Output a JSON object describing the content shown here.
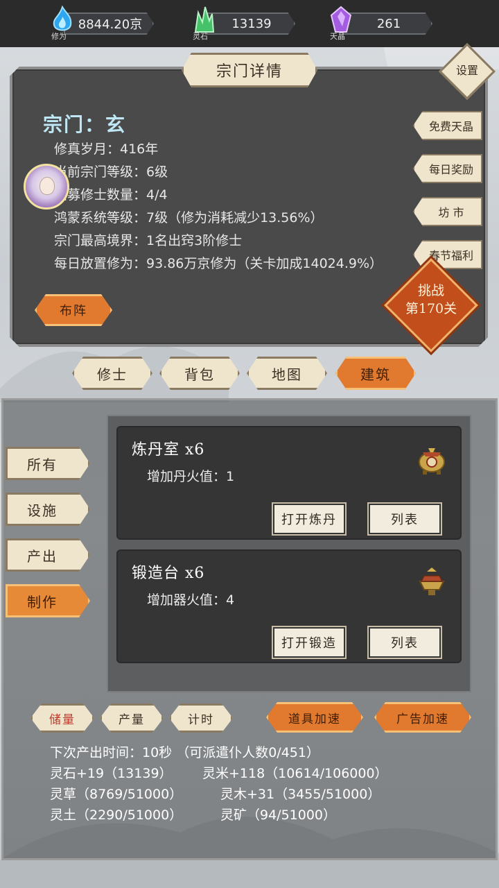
{
  "resources": [
    {
      "label": "修为",
      "value": "8844.20京",
      "color": "#2fa6f0"
    },
    {
      "label": "灵石",
      "value": "13139",
      "color": "#46c26a"
    },
    {
      "label": "天晶",
      "value": "261",
      "color": "#a45ce0"
    }
  ],
  "sect_panel": {
    "title": "宗门详情",
    "settings_label": "设置",
    "sect_name": "宗门：玄",
    "info_lines": [
      "修真岁月：416年",
      "当前宗门等级：6级",
      "招募修士数量：4/4",
      "鸿蒙系统等级：7级（修为消耗减少13.56%）",
      "宗门最高境界：1名出窍3阶修士",
      "每日放置修为：93.86万京修为（关卡加成14024.9%）"
    ],
    "side_buttons": [
      "免费天晶",
      "每日奖励",
      "坊 市",
      "春节福利"
    ],
    "challenge_line1": "挑战",
    "challenge_line2": "第170关",
    "formation_button": "布阵"
  },
  "tabs": [
    {
      "label": "修士",
      "active": false
    },
    {
      "label": "背包",
      "active": false
    },
    {
      "label": "地图",
      "active": false
    },
    {
      "label": "建筑",
      "active": true
    }
  ],
  "categories": [
    {
      "label": "所有",
      "active": false
    },
    {
      "label": "设施",
      "active": false
    },
    {
      "label": "产出",
      "active": false
    },
    {
      "label": "制作",
      "active": true
    }
  ],
  "buildings": [
    {
      "title": "炼丹室 x6",
      "desc": "增加丹火值：1",
      "open_label": "打开炼丹",
      "list_label": "列表",
      "icon": "alchemy-furnace-icon"
    },
    {
      "title": "锻造台 x6",
      "desc": "增加器火值：4",
      "open_label": "打开锻造",
      "list_label": "列表",
      "icon": "forge-anvil-icon"
    }
  ],
  "bottom_tabs": [
    {
      "label": "储量",
      "active": true
    },
    {
      "label": "产量",
      "active": false
    },
    {
      "label": "计时",
      "active": false
    }
  ],
  "speed_buttons": {
    "item": "道具加速",
    "ad": "广告加速"
  },
  "stats": {
    "next_output": "下次产出时间：10秒 （可派遣仆人数0/451）",
    "items": [
      "灵石+19（13139）",
      "灵米+118（10614/106000）",
      "灵草（8769/51000）",
      "灵木+31（3455/51000）",
      "灵土（2290/51000）",
      "灵矿（94/51000）"
    ]
  },
  "colors": {
    "accent_orange": "#e17a2e",
    "cream": "#efe4cc",
    "panel_dark": "#4a4a4a"
  }
}
